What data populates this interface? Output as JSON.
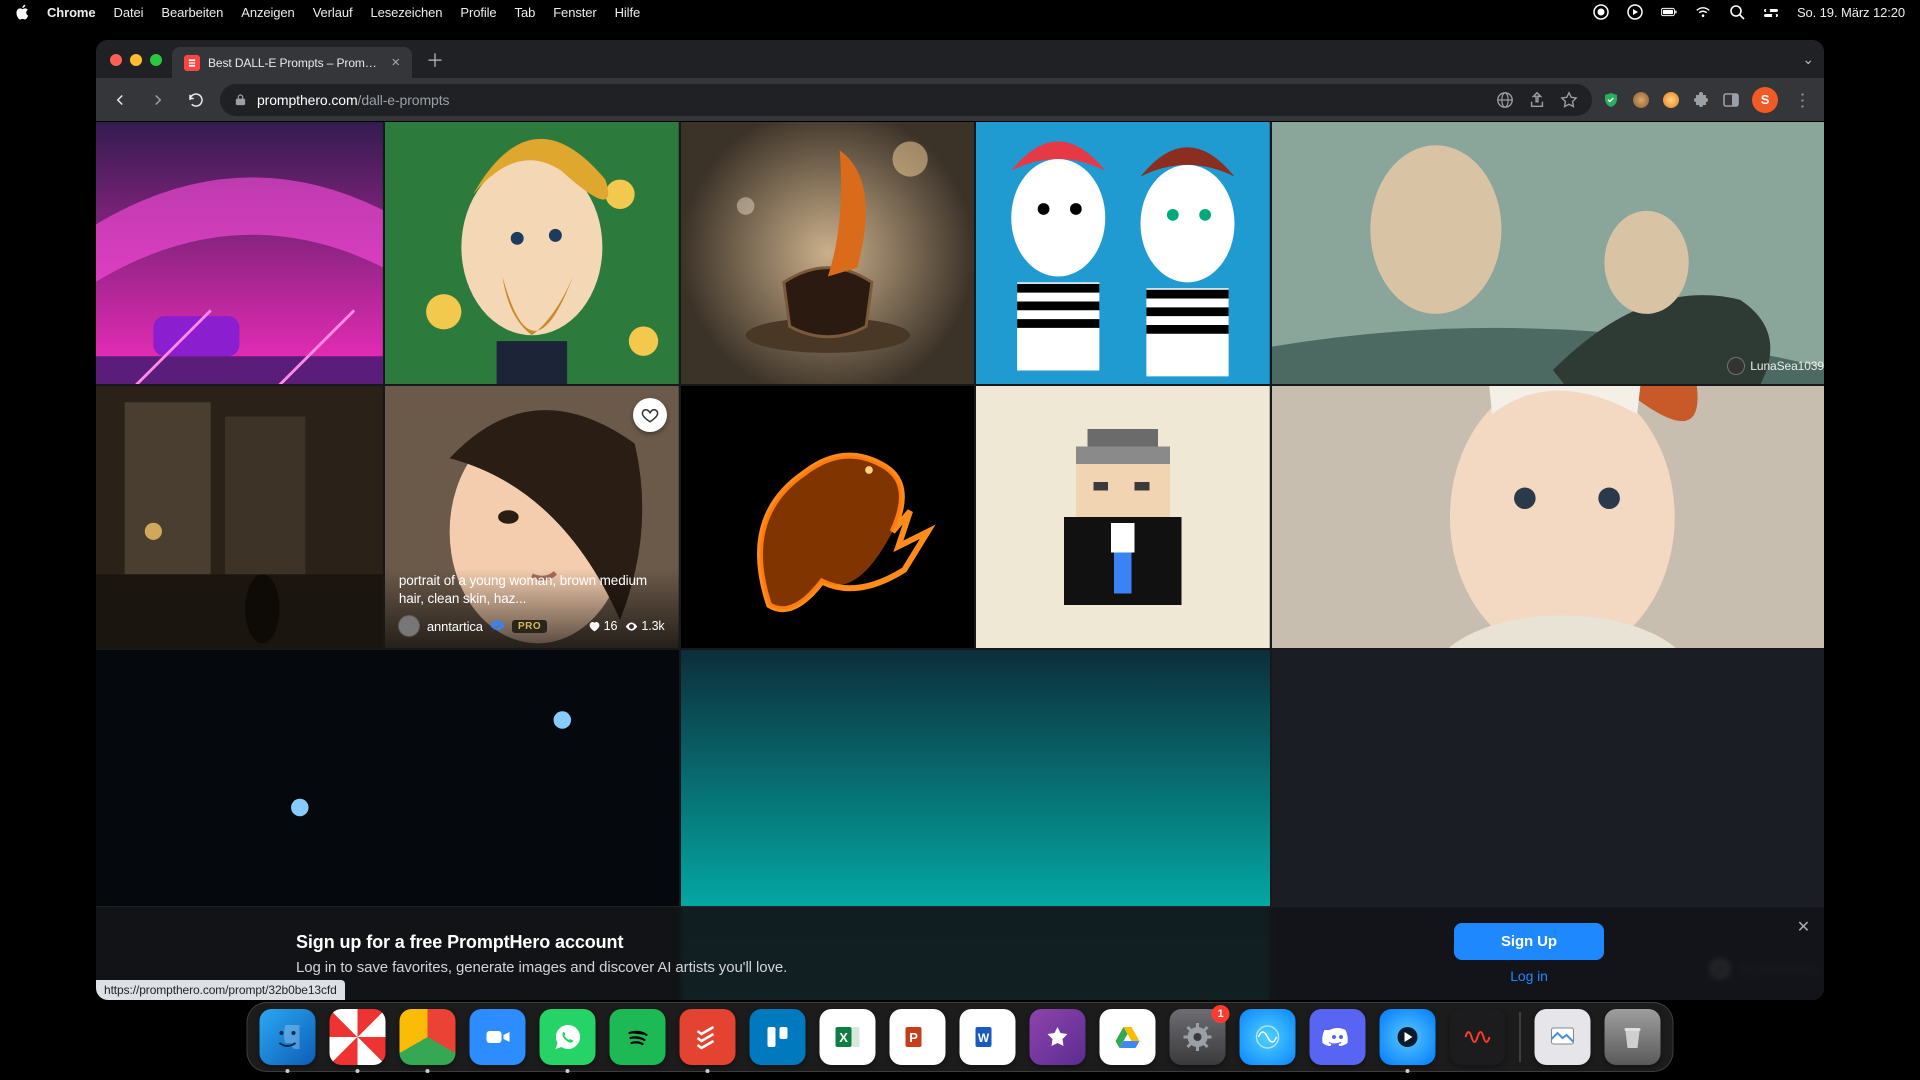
{
  "menubar": {
    "app": "Chrome",
    "items": [
      "Datei",
      "Bearbeiten",
      "Anzeigen",
      "Verlauf",
      "Lesezeichen",
      "Profile",
      "Tab",
      "Fenster",
      "Hilfe"
    ],
    "clock": "So. 19. März  12:20"
  },
  "browser": {
    "tab_title": "Best DALL-E Prompts – Prompt…",
    "url_host": "prompthero.com",
    "url_path": "/dall-e-prompts",
    "profile_letter": "S"
  },
  "tiles": {
    "r1c5_author": "LunaSea1039",
    "hover": {
      "caption": "portrait of a young woman, brown medium hair, clean skin, haz...",
      "author": "anntartica",
      "pro": "PRO",
      "likes": "16",
      "views": "1.3k"
    }
  },
  "banner": {
    "heading": "Sign up for a free PromptHero account",
    "sub": "Log in to save favorites, generate images and discover AI artists you'll love.",
    "signup": "Sign Up",
    "login": "Log in"
  },
  "watermark": "@prompthero",
  "status_url": "https://prompthero.com/prompt/32b0be13cfd",
  "dock": {
    "settings_badge": "1",
    "apps": [
      "Finder",
      "Safari",
      "Chrome",
      "Zoom",
      "WhatsApp",
      "Spotify",
      "Todoist",
      "Trello",
      "Excel",
      "PowerPoint",
      "Word",
      "iMovie",
      "Google Drive",
      "Systemeinstellungen",
      "Siri",
      "Discord",
      "QuickTime",
      "Sprachmemos"
    ]
  }
}
